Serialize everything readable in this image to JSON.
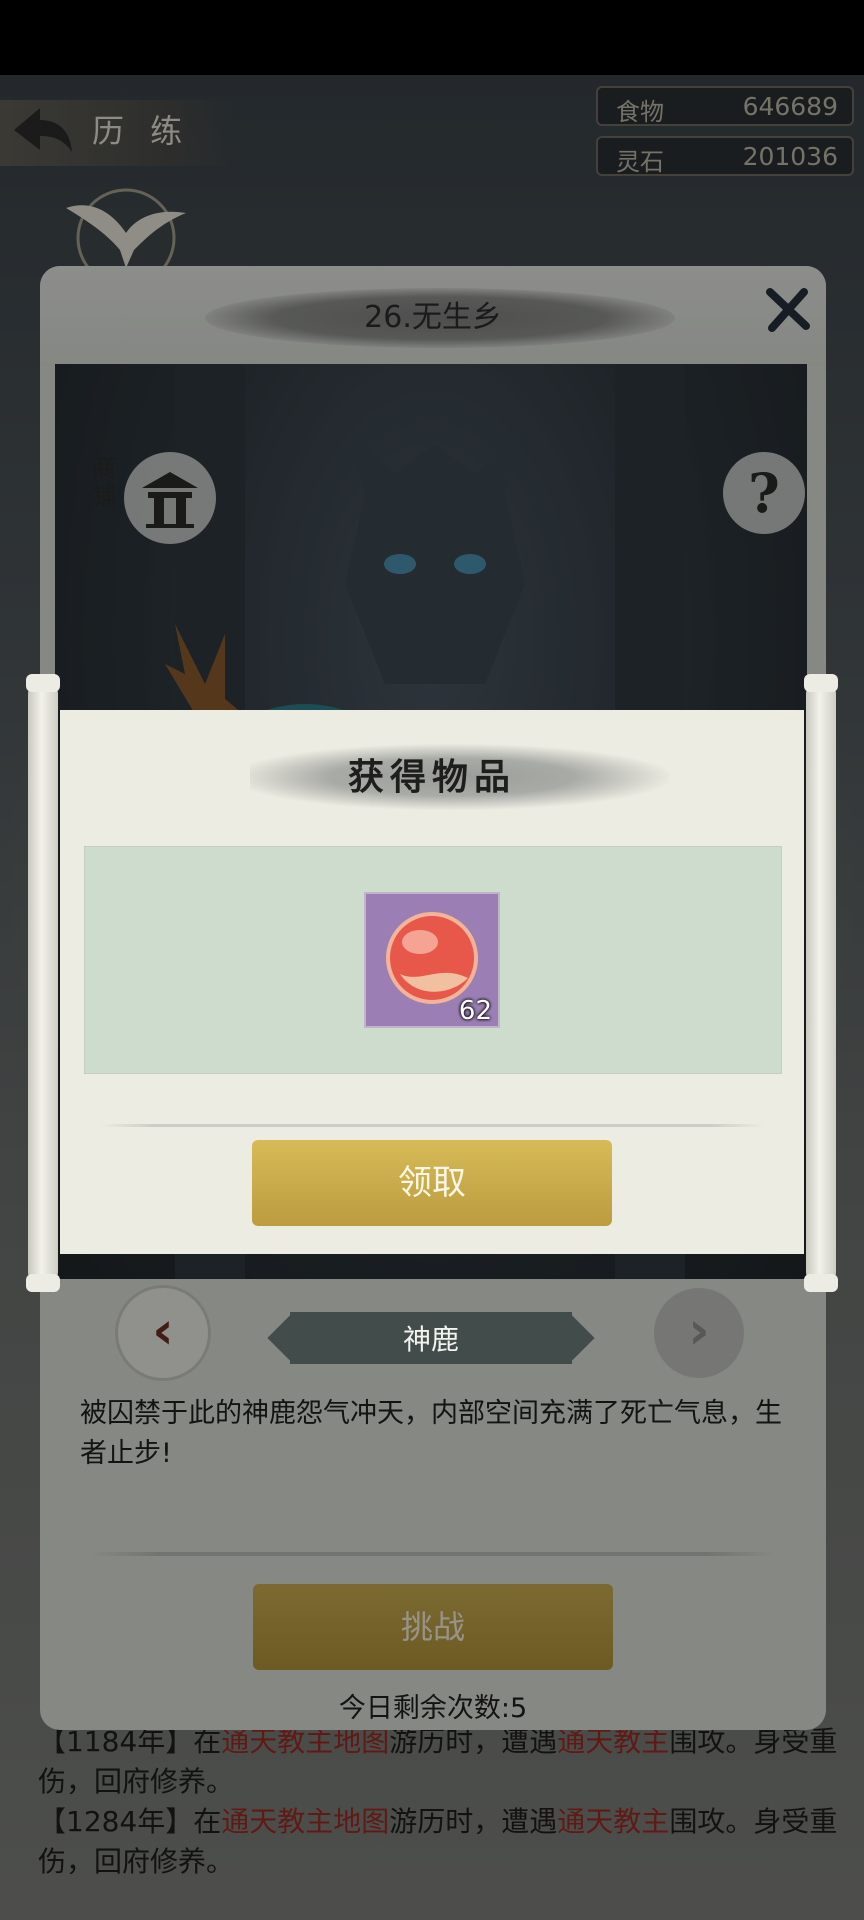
{
  "page": {
    "title": "历 练",
    "resources": [
      {
        "label": "食物",
        "value": "646689"
      },
      {
        "label": "灵石",
        "value": "201036"
      }
    ],
    "log": [
      {
        "prefix": "【1184年】在",
        "place": "通天教主地图",
        "mid": "游历时，遭遇",
        "enemy": "通天教主",
        "suffix": "围攻。身受重伤，回府修养。"
      },
      {
        "prefix": "【1284年】在",
        "place": "通天教主地图",
        "mid": "游历时，遭遇",
        "enemy": "通天教主",
        "suffix": "围攻。身受重伤，回府修养。"
      }
    ]
  },
  "level_dialog": {
    "title": "26.无生乡",
    "shop_label": "商铺",
    "help_label": "?",
    "prev_label": "‹",
    "next_label": "›",
    "boss_name": "神鹿",
    "description": "被囚禁于此的神鹿怨气冲天，内部空间充满了死亡气息，生者止步!",
    "challenge_label": "挑战",
    "remaining_text": "今日剩余次数:5"
  },
  "reward_popup": {
    "title": "获得物品",
    "items": [
      {
        "icon": "red-orb-icon",
        "count": "62"
      }
    ],
    "claim_label": "领取"
  },
  "colors": {
    "gold_button": "#c9ad4d",
    "item_bg": "#9b7fb4",
    "panel_green": "#cddccd",
    "highlight_red": "#9a2a22"
  }
}
